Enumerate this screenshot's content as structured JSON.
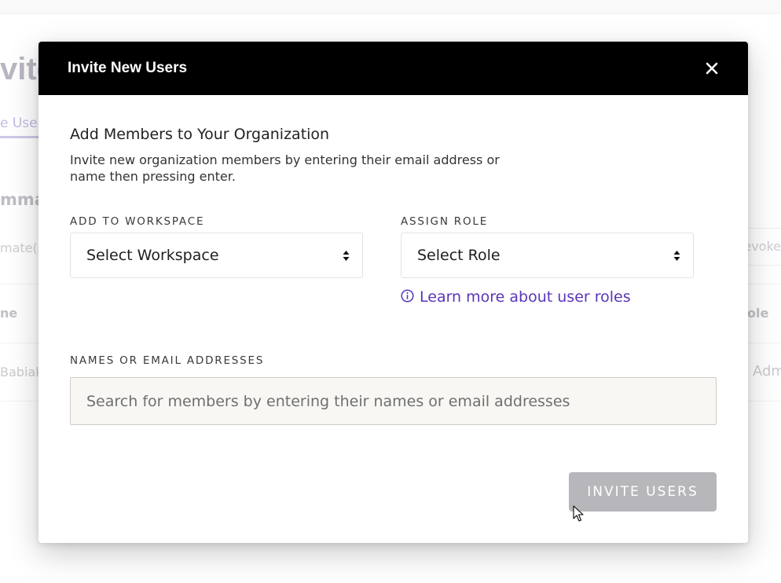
{
  "background": {
    "title_fragment": "vite",
    "tab_fragment": "e User",
    "section_fragment": "mmat",
    "teammates_fragment": "mate(s",
    "revoke_fragment": "evoke",
    "column_left_fragment": "ne",
    "column_right_fragment": "ole",
    "cell_left_fragment": "Babiak",
    "cell_right_fragment": "Adm"
  },
  "modal": {
    "title": "Invite New Users",
    "close_icon": "close-icon",
    "heading": "Add Members to Your Organization",
    "description": "Invite new organization members by entering their email address or name then pressing enter.",
    "workspace": {
      "label": "ADD TO WORKSPACE",
      "selected": "Select Workspace"
    },
    "role": {
      "label": "ASSIGN ROLE",
      "selected": "Select Role",
      "learn_more": "Learn more about user roles"
    },
    "names": {
      "label": "NAMES OR EMAIL ADDRESSES",
      "placeholder": "Search for members by entering their names or email addresses",
      "value": ""
    },
    "invite_button": "INVITE USERS"
  },
  "colors": {
    "header_bg": "#000000",
    "link": "#5a35b8",
    "button_disabled": "#b7b7bb",
    "input_bg": "#f8f7f3"
  }
}
